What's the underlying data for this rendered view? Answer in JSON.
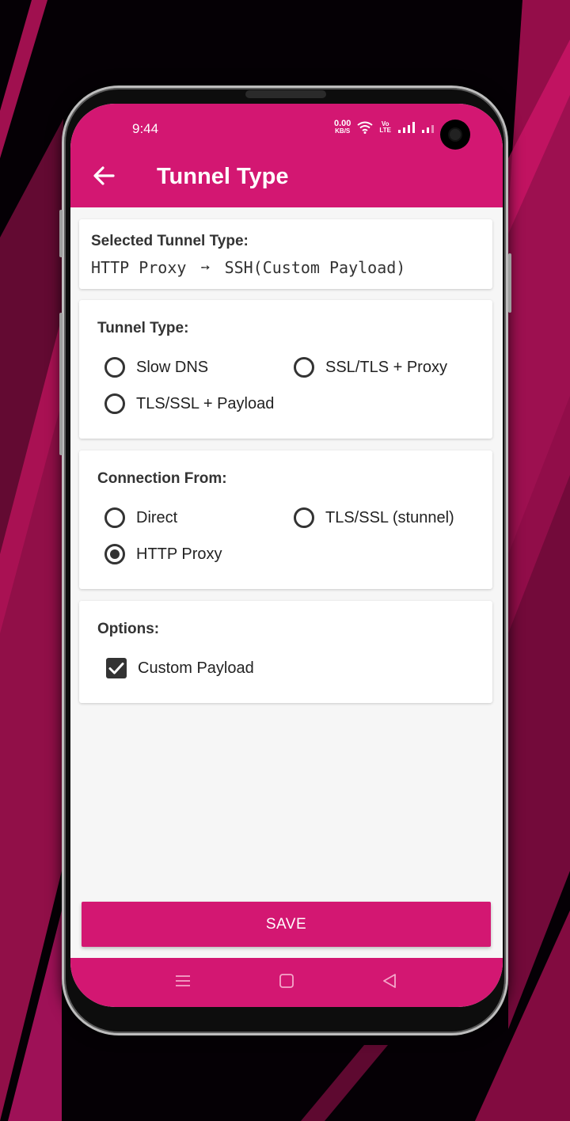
{
  "colors": {
    "accent": "#d31772",
    "background": "#f6f6f6",
    "text": "#222222"
  },
  "status_bar": {
    "time": "9:44",
    "net_speed_value": "0.00",
    "net_speed_unit": "KB/S",
    "volte_top": "Vo",
    "volte_bottom": "LTE",
    "icons": [
      "wifi-icon",
      "volte-icon",
      "signal-icon",
      "signal-icon-2",
      "battery-icon"
    ]
  },
  "app_bar": {
    "title": "Tunnel Type",
    "back_icon": "arrow-left-icon"
  },
  "selected": {
    "label": "Selected Tunnel Type:",
    "from": "HTTP Proxy",
    "arrow": "➙",
    "to": "SSH(Custom Payload)"
  },
  "tunnel_type": {
    "label": "Tunnel Type:",
    "options": [
      {
        "label": "Slow DNS",
        "checked": false
      },
      {
        "label": "SSL/TLS + Proxy",
        "checked": false
      },
      {
        "label": "TLS/SSL + Payload",
        "checked": false
      }
    ]
  },
  "connection_from": {
    "label": "Connection From:",
    "options": [
      {
        "label": "Direct",
        "checked": false
      },
      {
        "label": "TLS/SSL (stunnel)",
        "checked": false
      },
      {
        "label": "HTTP Proxy",
        "checked": true
      }
    ]
  },
  "options": {
    "label": "Options:",
    "items": [
      {
        "label": "Custom Payload",
        "checked": true
      }
    ]
  },
  "save_label": "SAVE",
  "nav_bar": {
    "icons": [
      "menu-icon",
      "home-icon",
      "back-triangle-icon"
    ]
  }
}
